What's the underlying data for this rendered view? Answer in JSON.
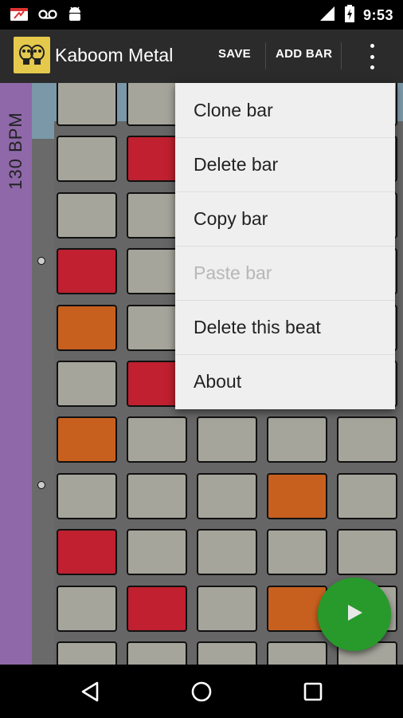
{
  "status_bar": {
    "time": "9:53",
    "icons": [
      "calendar-icon",
      "voicemail-icon",
      "android-icon",
      "signal-icon",
      "battery-charging-icon"
    ]
  },
  "action_bar": {
    "app_icon": "gas-mask-icon",
    "title": "Kaboom Metal",
    "save_label": "SAVE",
    "add_bar_label": "ADD BAR",
    "overflow_icon": "more-vert-icon"
  },
  "sequencer": {
    "bpm_label": "130 BPM",
    "visible_rows": [
      [
        "gray",
        "gray",
        "gray",
        "gray",
        "gray"
      ],
      [
        "gray",
        "red",
        "gray",
        "gray",
        "red"
      ],
      [
        "gray",
        "gray",
        "gray",
        "gray",
        "gray"
      ],
      [
        "red",
        "gray",
        "gray",
        "gray",
        "gray"
      ],
      [
        "orange",
        "gray",
        "gray",
        "gray",
        "gray"
      ],
      [
        "gray",
        "red",
        "gray",
        "gray",
        "gray"
      ],
      [
        "orange",
        "gray",
        "gray",
        "gray",
        "gray"
      ],
      [
        "gray",
        "gray",
        "gray",
        "orange",
        "gray"
      ],
      [
        "red",
        "gray",
        "gray",
        "gray",
        "gray"
      ],
      [
        "gray",
        "red",
        "gray",
        "orange",
        "gray"
      ],
      [
        "gray",
        "gray",
        "gray",
        "gray",
        "gray"
      ]
    ],
    "colors": {
      "gray": "#a6a59c",
      "red": "#c0202f",
      "orange": "#c7601f",
      "bpm_strip": "#8f68a9"
    }
  },
  "menu": {
    "items": [
      {
        "label": "Clone bar",
        "enabled": true
      },
      {
        "label": "Delete bar",
        "enabled": true
      },
      {
        "label": "Copy bar",
        "enabled": true
      },
      {
        "label": "Paste bar",
        "enabled": false
      },
      {
        "label": "Delete this beat",
        "enabled": true
      },
      {
        "label": "About",
        "enabled": true
      }
    ]
  },
  "fab": {
    "icon": "play-icon",
    "color": "#279a2b"
  },
  "nav_bar": {
    "icons": [
      "back-icon",
      "home-icon",
      "recents-icon"
    ]
  }
}
